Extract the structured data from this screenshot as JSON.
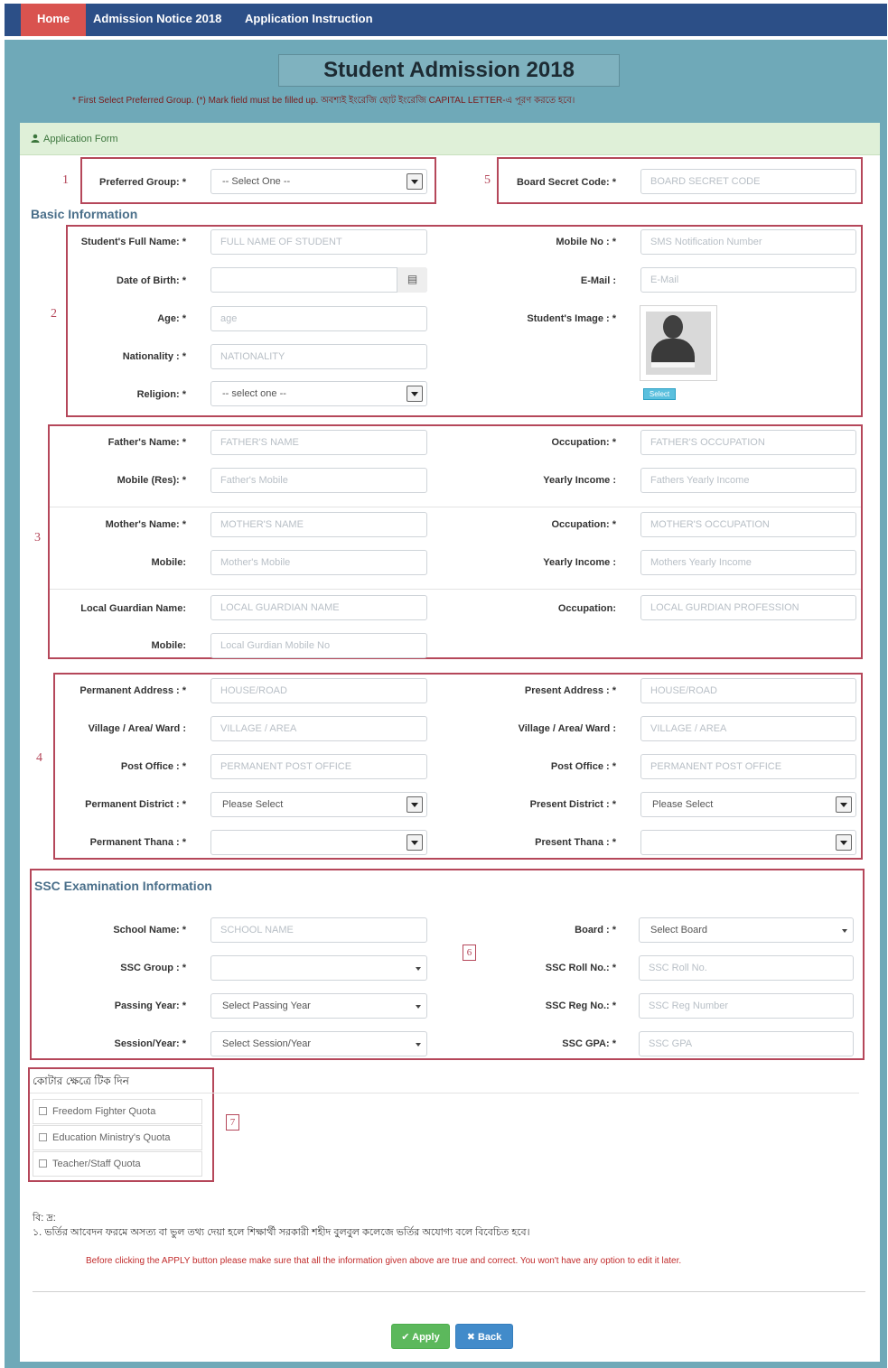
{
  "nav": {
    "home": "Home",
    "notice": "Admission Notice 2018",
    "instruction": "Application Instruction"
  },
  "header": {
    "title": "Student Admission 2018",
    "note": "* First Select Preferred Group. (*) Mark field must be filled up. অবশ্যই ইংরেজি ছোট ইংরেজি CAPITAL LETTER-এ পূরণ করতে হবে।"
  },
  "panel": {
    "title": "Application Form"
  },
  "markers": [
    "1",
    "2",
    "3",
    "4",
    "5",
    "6",
    "7"
  ],
  "top": {
    "group_label": "Preferred Group: *",
    "group_value": "-- Select One --",
    "secret_label": "Board Secret Code: *",
    "secret_placeholder": "BOARD SECRET CODE"
  },
  "basic": {
    "title": "Basic Information",
    "name_label": "Student's Full Name: *",
    "name_placeholder": "FULL NAME OF STUDENT",
    "dob_label": "Date of Birth: *",
    "age_label": "Age: *",
    "age_placeholder": "age",
    "nationality_label": "Nationality : *",
    "nationality_placeholder": "NATIONALITY",
    "religion_label": "Religion: *",
    "religion_value": "-- select one --",
    "mobile_label": "Mobile No : *",
    "mobile_placeholder": "SMS Notification Number",
    "email_label": "E-Mail :",
    "email_placeholder": "E-Mail",
    "image_label": "Student's Image : *",
    "image_button": "Select"
  },
  "parents": {
    "father_label": "Father's Name: *",
    "father_placeholder": "FATHER'S NAME",
    "father_mobile_label": "Mobile (Res): *",
    "father_mobile_placeholder": "Father's Mobile",
    "father_occ_label": "Occupation: *",
    "father_occ_placeholder": "FATHER'S OCCUPATION",
    "father_income_label": "Yearly Income :",
    "father_income_placeholder": "Fathers Yearly Income",
    "mother_label": "Mother's Name: *",
    "mother_placeholder": "MOTHER'S NAME",
    "mother_mobile_label": "Mobile:",
    "mother_mobile_placeholder": "Mother's Mobile",
    "mother_occ_label": "Occupation: *",
    "mother_occ_placeholder": "MOTHER'S OCCUPATION",
    "mother_income_label": "Yearly Income :",
    "mother_income_placeholder": "Mothers Yearly Income",
    "guardian_label": "Local Guardian Name:",
    "guardian_placeholder": "LOCAL GUARDIAN NAME",
    "guardian_occ_label": "Occupation:",
    "guardian_occ_placeholder": "LOCAL GURDIAN PROFESSION",
    "guardian_mobile_label": "Mobile:",
    "guardian_mobile_placeholder": "Local Gurdian Mobile No"
  },
  "address": {
    "perm_label": "Permanent Address : *",
    "perm_placeholder": "HOUSE/ROAD",
    "perm_village_label": "Village / Area/ Ward :",
    "perm_village_placeholder": "VILLAGE / AREA",
    "perm_po_label": "Post Office : *",
    "perm_po_placeholder": "PERMANENT POST OFFICE",
    "perm_district_label": "Permanent District : *",
    "perm_district_value": "Please Select",
    "perm_thana_label": "Permanent Thana : *",
    "pres_label": "Present Address : *",
    "pres_placeholder": "HOUSE/ROAD",
    "pres_village_label": "Village / Area/ Ward :",
    "pres_village_placeholder": "VILLAGE / AREA",
    "pres_po_label": "Post Office : *",
    "pres_po_placeholder": "PERMANENT POST OFFICE",
    "pres_district_label": "Present District : *",
    "pres_district_value": "Please Select",
    "pres_thana_label": "Present Thana : *"
  },
  "ssc": {
    "title": "SSC Examination Information",
    "school_label": "School Name: *",
    "school_placeholder": "SCHOOL NAME",
    "group_label": "SSC Group : *",
    "year_label": "Passing Year: *",
    "year_value": "Select Passing Year",
    "session_label": "Session/Year: *",
    "session_value": "Select Session/Year",
    "board_label": "Board : *",
    "board_value": "Select Board",
    "roll_label": "SSC Roll No.: *",
    "roll_placeholder": "SSC Roll No.",
    "reg_label": "SSC Reg No.: *",
    "reg_placeholder": "SSC Reg Number",
    "gpa_label": "SSC GPA: *",
    "gpa_placeholder": "SSC GPA"
  },
  "quota": {
    "title": "কোটার ক্ষেত্রে টিক দিন",
    "items": [
      "Freedom Fighter Quota",
      "Education Ministry's Quota",
      "Teacher/Staff Quota"
    ]
  },
  "notes": {
    "heading": "বি: দ্র:",
    "line": "১. ভর্তির আবেদন ফরমে অসত্য বা ভুল তথ্য দেয়া হলে শিক্ষার্থী সরকারী শহীদ বুলবুল কলেজে ভর্তির অযোগ্য বলে বিবেচিত হবে।",
    "warning": "Before clicking the APPLY button please make sure that all the information given above are true and correct. You won't have any option to edit it later."
  },
  "buttons": {
    "apply": "✔ Apply",
    "back": "✖ Back"
  },
  "colors": {
    "nav": "#2c4f87",
    "home": "#d9534f",
    "frame": "#6fa9b8",
    "marker": "#b5475a",
    "apply": "#5cb85c",
    "back": "#428bca"
  }
}
